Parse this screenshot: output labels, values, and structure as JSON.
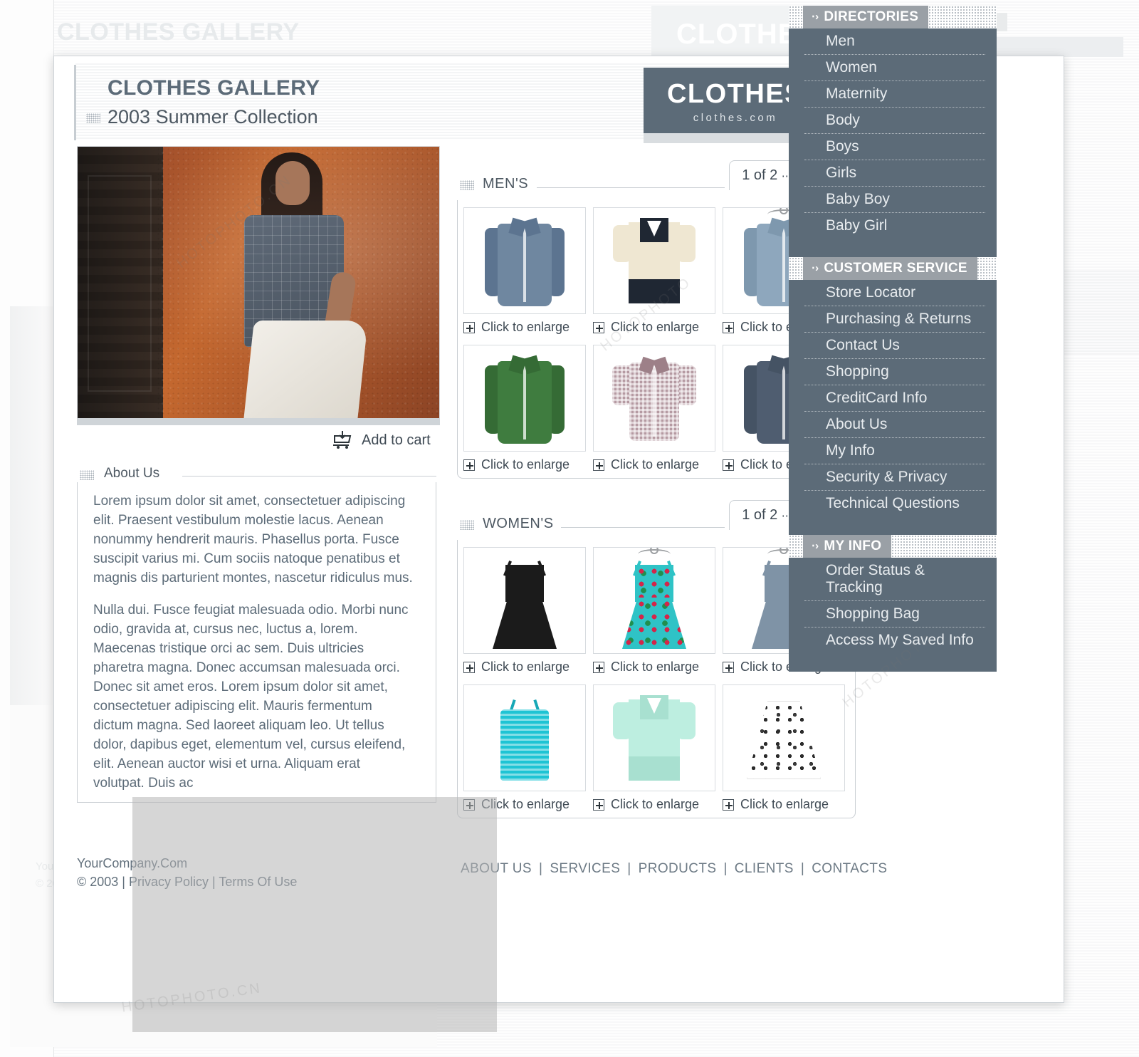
{
  "background": {
    "ghost_title": "CLOTHES GALLERY",
    "ghost_logo": "CLOTHES",
    "ghost_nav_header": "DIRECTORIES",
    "ghost_nav_item": "Men",
    "ghost_footer_line1": "YourCompany.Com",
    "ghost_footer_line2": "© 2003 | Privacy Policy | Terms Of Use",
    "ghost_right_text": "ng"
  },
  "header": {
    "title": "CLOTHES GALLERY",
    "subtitle": "2003 Summer Collection",
    "logo_main": "CLOTHES",
    "logo_sub": "clothes.com"
  },
  "hero": {
    "add_to_cart": "Add to cart",
    "cart_icon": "shopping-cart-icon"
  },
  "about": {
    "label": "About Us",
    "paragraph1": "Lorem ipsum dolor sit amet, consectetuer adipiscing elit. Praesent vestibulum molestie lacus. Aenean nonummy hendrerit mauris. Phasellus porta. Fusce suscipit varius mi. Cum sociis natoque penatibus et magnis dis parturient montes, nascetur ridiculus mus.",
    "paragraph2": "Nulla dui. Fusce feugiat malesuada odio. Morbi nunc odio, gravida at, cursus nec, luctus a, lorem. Maecenas tristique orci ac sem. Duis ultricies pharetra magna. Donec accumsan malesuada orci. Donec sit amet eros. Lorem ipsum dolor sit amet, consectetuer adipiscing elit. Mauris fermentum dictum magna. Sed laoreet aliquam leo. Ut tellus dolor, dapibus eget, elementum vel, cursus eleifend, elit. Aenean auctor wisi et urna. Aliquam erat volutpat. Duis ac"
  },
  "sections": [
    {
      "title": "MEN'S",
      "pager": "1 of 2",
      "pager_arrow": "⋯→",
      "rows": [
        [
          {
            "caption": "Click to enlarge",
            "kind": "shirt-ls",
            "color": "#6f87a0",
            "accent": "#5c7490"
          },
          {
            "caption": "Click to enlarge",
            "kind": "polo",
            "color": "#efe7d2",
            "accent": "#1f2733"
          },
          {
            "caption": "Click to enlarge",
            "kind": "shirt-ls",
            "color": "#8ea7bd",
            "accent": "#7e98ae",
            "hanger": true
          }
        ],
        [
          {
            "caption": "Click to enlarge",
            "kind": "shirt-ls",
            "color": "#3f7c3f",
            "accent": "#356b35"
          },
          {
            "caption": "Click to enlarge",
            "kind": "shirt-ss",
            "color": "#b59aa2",
            "accent": "#9d8088"
          },
          {
            "caption": "Click to enlarge",
            "kind": "shirt-ls",
            "color": "#4f5d70",
            "accent": "#455364"
          }
        ]
      ]
    },
    {
      "title": "WOMEN'S",
      "pager": "1 of 2",
      "pager_arrow": "⋯→",
      "rows": [
        [
          {
            "caption": "Click to enlarge",
            "kind": "dress",
            "color": "#1b1b1b",
            "accent": "#2a2a2a"
          },
          {
            "caption": "Click to enlarge",
            "kind": "dress",
            "color": "#2fc3c6",
            "accent": "#d3264a",
            "hanger": true,
            "floral": true
          },
          {
            "caption": "Click to enlarge",
            "kind": "dress",
            "color": "#7f93a6",
            "accent": "#7f93a6",
            "hanger": true
          }
        ],
        [
          {
            "caption": "Click to enlarge",
            "kind": "tank",
            "color": "#1ec4d4",
            "accent": "#16a8b6"
          },
          {
            "caption": "Click to enlarge",
            "kind": "polo",
            "color": "#bdeee0",
            "accent": "#a8e0d0"
          },
          {
            "caption": "Click to enlarge",
            "kind": "skirt",
            "color": "#ffffff",
            "accent": "#2c2c2c"
          }
        ]
      ]
    }
  ],
  "sidebar": {
    "arrow": "⋅›",
    "groups": [
      {
        "header": "DIRECTORIES",
        "items": [
          "Men",
          "Women",
          "Maternity",
          "Body",
          "Boys",
          "Girls",
          "Baby Boy",
          "Baby Girl"
        ]
      },
      {
        "header": "CUSTOMER SERVICE",
        "items": [
          "Store Locator",
          "Purchasing & Returns",
          "Contact Us",
          "Shopping",
          "CreditCard Info",
          "About Us",
          "My Info",
          "Security & Privacy",
          "Technical Questions"
        ]
      },
      {
        "header": "MY INFO",
        "items": [
          "Order Status & Tracking",
          "Shopping Bag",
          "Access My Saved Info"
        ]
      }
    ]
  },
  "footer": {
    "company": "YourCompany.Com",
    "legal": "© 2003 | Privacy Policy | Terms Of Use",
    "nav": [
      "ABOUT US",
      "SERVICES",
      "PRODUCTS",
      "CLIENTS",
      "CONTACTS"
    ],
    "separator": "|"
  },
  "colors": {
    "brand": "#5c6b78",
    "text": "#4d5862",
    "border": "#c9ced3",
    "nav_header_bg": "#9aa0a6"
  }
}
